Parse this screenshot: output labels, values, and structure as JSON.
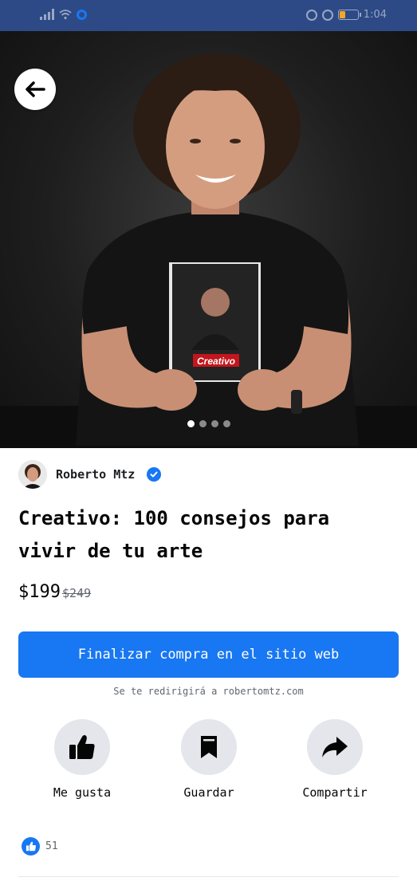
{
  "status_bar": {
    "time": "1:04"
  },
  "hero": {
    "active_slide": 1,
    "slide_count": 4,
    "book_cover_text": "Creativo"
  },
  "seller": {
    "name": "Roberto Mtz",
    "verified": true
  },
  "listing": {
    "title": "Creativo: 100 consejos para vivir de tu arte",
    "price": "$199",
    "original_price": "$249"
  },
  "cta": {
    "label": "Finalizar compra en el sitio web",
    "redirect_note": "Se te redirigirá a robertomtz.com"
  },
  "actions": {
    "like_label": "Me gusta",
    "save_label": "Guardar",
    "share_label": "Compartir"
  },
  "reactions": {
    "count": "51"
  },
  "colors": {
    "accent": "#1877f2",
    "status_bar": "#2d4a86",
    "action_bg": "#e4e6eb"
  },
  "icons": [
    "back-arrow-icon",
    "verified-icon",
    "thumbs-up-icon",
    "bookmark-icon",
    "share-icon"
  ]
}
